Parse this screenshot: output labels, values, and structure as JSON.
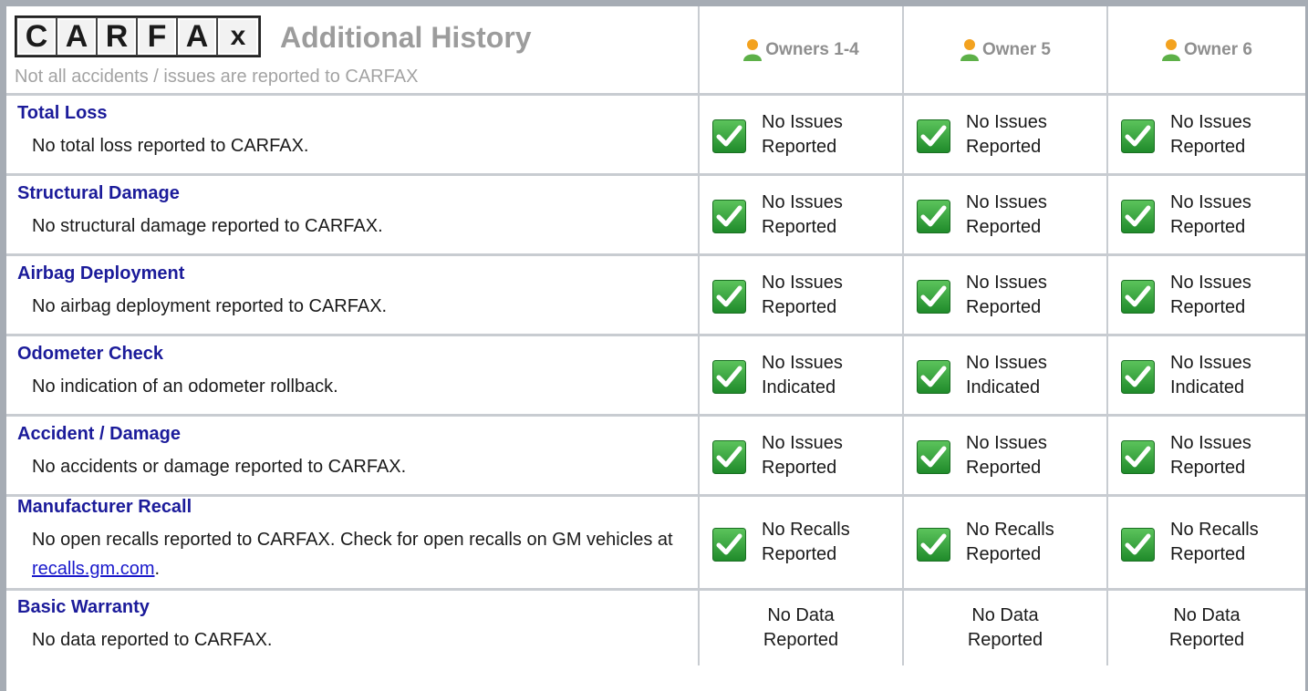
{
  "header": {
    "logo_letters": [
      "C",
      "A",
      "R",
      "F",
      "A",
      "x"
    ],
    "title": "Additional History",
    "subtitle": "Not all accidents / issues are reported to CARFAX",
    "owners": [
      "Owners 1-4",
      "Owner 5",
      "Owner 6"
    ]
  },
  "icons": {
    "owner": "person-icon",
    "status": "green-check-icon"
  },
  "colors": {
    "item_title": "#1b1b9a",
    "link": "#1a1acc",
    "check_green": "#2f9a2f",
    "frame": "#a6acb4"
  },
  "rows": [
    {
      "title": "Total Loss",
      "desc": "No total loss reported to CARFAX.",
      "status": [
        {
          "line1": "No Issues",
          "line2": "Reported"
        },
        {
          "line1": "No Issues",
          "line2": "Reported"
        },
        {
          "line1": "No Issues",
          "line2": "Reported"
        }
      ]
    },
    {
      "title": "Structural Damage",
      "desc": "No structural damage reported to CARFAX.",
      "status": [
        {
          "line1": "No Issues",
          "line2": "Reported"
        },
        {
          "line1": "No Issues",
          "line2": "Reported"
        },
        {
          "line1": "No Issues",
          "line2": "Reported"
        }
      ]
    },
    {
      "title": "Airbag Deployment",
      "desc": "No airbag deployment reported to CARFAX.",
      "status": [
        {
          "line1": "No Issues",
          "line2": "Reported"
        },
        {
          "line1": "No Issues",
          "line2": "Reported"
        },
        {
          "line1": "No Issues",
          "line2": "Reported"
        }
      ]
    },
    {
      "title": "Odometer Check",
      "desc": "No indication of an odometer rollback.",
      "status": [
        {
          "line1": "No Issues",
          "line2": "Indicated"
        },
        {
          "line1": "No Issues",
          "line2": "Indicated"
        },
        {
          "line1": "No Issues",
          "line2": "Indicated"
        }
      ]
    },
    {
      "title": "Accident / Damage",
      "desc": "No accidents or damage reported to CARFAX.",
      "status": [
        {
          "line1": "No Issues",
          "line2": "Reported"
        },
        {
          "line1": "No Issues",
          "line2": "Reported"
        },
        {
          "line1": "No Issues",
          "line2": "Reported"
        }
      ]
    },
    {
      "title": "Manufacturer Recall",
      "desc_prefix": "No open recalls reported to CARFAX. Check for open recalls on GM vehicles at ",
      "desc_link": "recalls.gm.com",
      "desc_suffix": ".",
      "status": [
        {
          "line1": "No Recalls",
          "line2": "Reported"
        },
        {
          "line1": "No Recalls",
          "line2": "Reported"
        },
        {
          "line1": "No Recalls",
          "line2": "Reported"
        }
      ]
    },
    {
      "title": "Basic Warranty",
      "desc": "No data reported to CARFAX.",
      "status": [
        {
          "line1": "No Data",
          "line2": "Reported"
        },
        {
          "line1": "No Data",
          "line2": "Reported"
        },
        {
          "line1": "No Data",
          "line2": "Reported"
        }
      ]
    }
  ]
}
